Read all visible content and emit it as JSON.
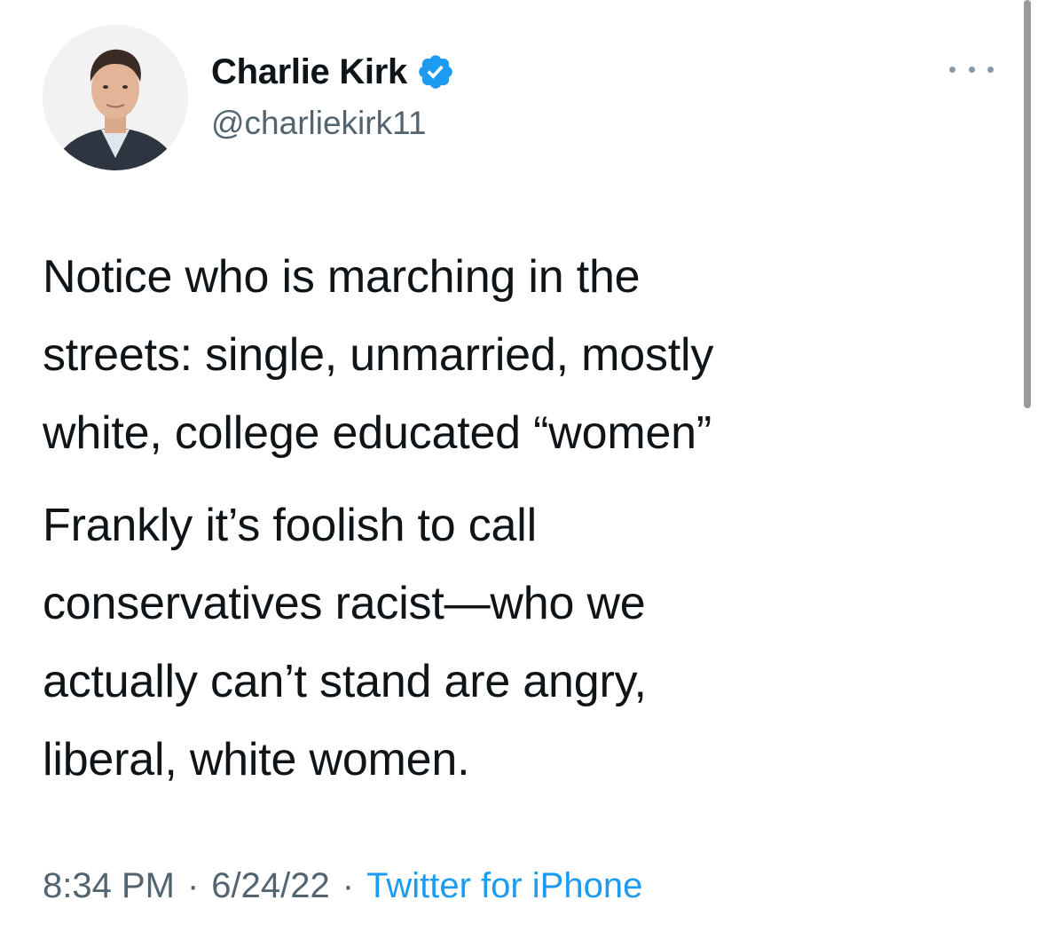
{
  "author": {
    "display_name": "Charlie Kirk",
    "handle": "@charliekirk11",
    "verified": true,
    "avatar_icon": "profile-photo"
  },
  "tweet": {
    "paragraphs": [
      "Notice who is marching in the\nstreets: single, unmarried, mostly\nwhite, college educated “women”",
      "Frankly it’s foolish to call\nconservatives racist—who we\nactually can’t stand are angry,\nliberal, white women."
    ],
    "time": "8:34 PM",
    "date": "6/24/22",
    "source": "Twitter for iPhone",
    "separator": "·"
  },
  "icons": {
    "verified": "verified-badge-icon",
    "more": "more-options-icon"
  },
  "colors": {
    "text": "#0f1419",
    "secondary": "#536471",
    "accent": "#1d9bf0"
  }
}
